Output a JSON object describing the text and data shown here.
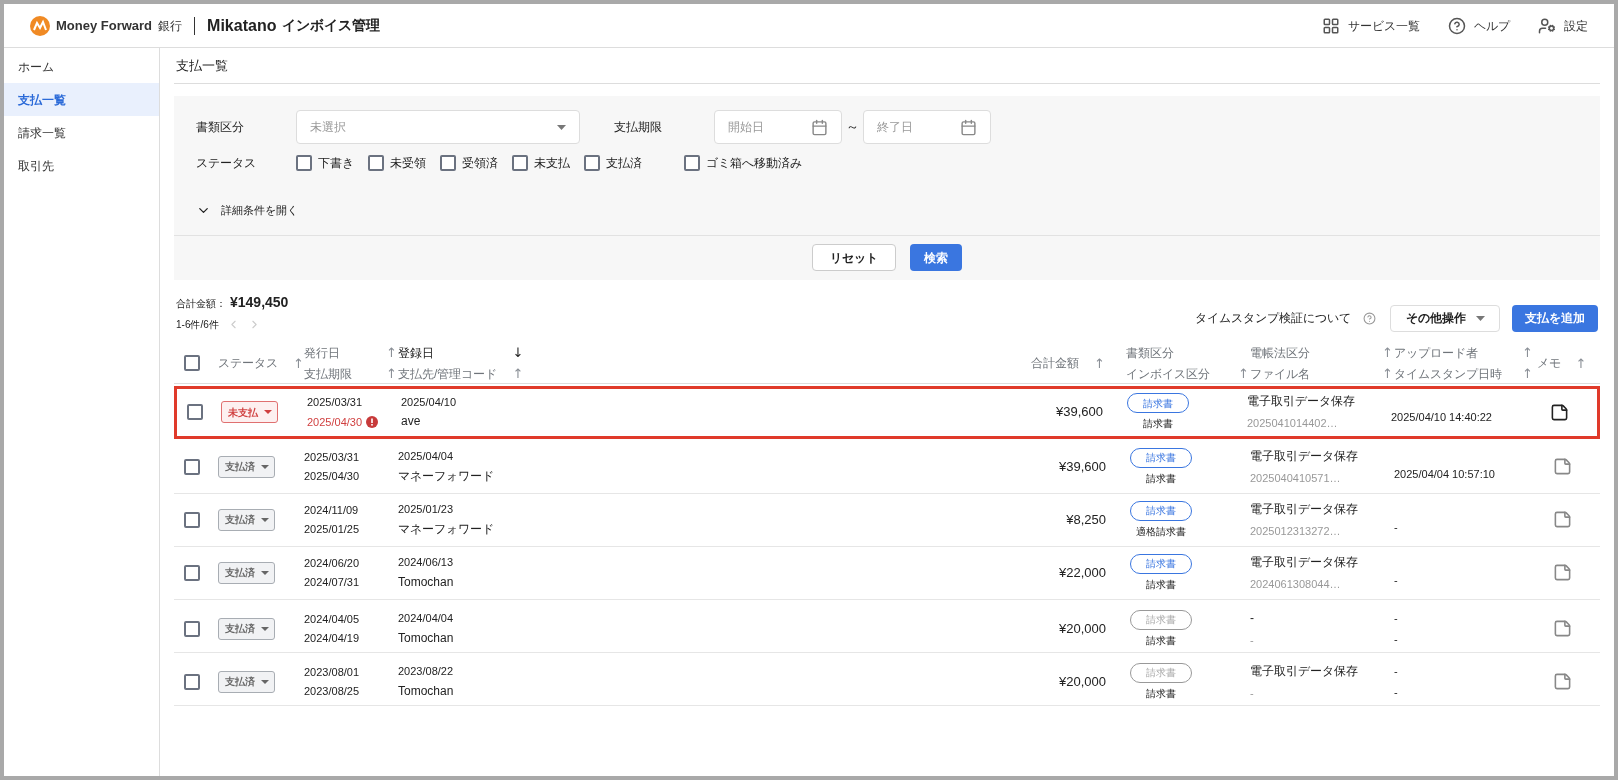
{
  "header": {
    "brand": "Money Forward",
    "brand_sub": "銀行",
    "product": "Mikatano",
    "product_sub": "インボイス管理",
    "nav": [
      {
        "kind": "grid",
        "label": "サービス一覧"
      },
      {
        "kind": "help",
        "label": "ヘルプ"
      },
      {
        "kind": "settings",
        "label": "設定"
      }
    ]
  },
  "sidebar": {
    "items": [
      {
        "label": "ホーム",
        "selected": false
      },
      {
        "label": "支払一覧",
        "selected": true
      },
      {
        "label": "請求一覧",
        "selected": false
      },
      {
        "label": "取引先",
        "selected": false
      }
    ]
  },
  "page_title": "支払一覧",
  "filters": {
    "doc_type": {
      "label": "書類区分",
      "placeholder": "未選択"
    },
    "due": {
      "label": "支払期限",
      "start_placeholder": "開始日",
      "separator": "～",
      "end_placeholder": "終了日"
    },
    "status": {
      "label": "ステータス",
      "options": [
        {
          "label": "下書き",
          "checked": false
        },
        {
          "label": "未受領",
          "checked": false
        },
        {
          "label": "受領済",
          "checked": false
        },
        {
          "label": "未支払",
          "checked": false
        },
        {
          "label": "支払済",
          "checked": false
        },
        {
          "label": "ゴミ箱へ移動済み",
          "checked": false
        }
      ]
    },
    "details_toggle": "詳細条件を開く",
    "reset": "リセット",
    "search": "検索"
  },
  "summary": {
    "total_label": "合計金額：",
    "total": "¥149,450",
    "count": "1-6件/6件"
  },
  "toolbar": {
    "timestamp_link": "タイムスタンプ検証について",
    "other_ops": "その他操作",
    "add": "支払を追加"
  },
  "table": {
    "all_checked": false,
    "columns": [
      {
        "lines": [
          {
            "label": "ステータス",
            "arrow": "↑",
            "active": false
          }
        ]
      },
      {
        "lines": [
          {
            "label": "発行日",
            "arrow": "↑",
            "active": false
          },
          {
            "label": "支払期限",
            "arrow": "↑",
            "active": false
          }
        ]
      },
      {
        "lines": [
          {
            "label": "登録日",
            "arrow": "↓",
            "active": true
          },
          {
            "label": "支払先/管理コード",
            "arrow": "↑",
            "active": false
          }
        ]
      },
      {
        "lines": [
          {
            "label": "合計金額",
            "arrow": "↑",
            "active": false
          }
        ]
      },
      {
        "lines": [
          {
            "label": "書類区分",
            "active": false
          },
          {
            "label": "インボイス区分",
            "arrow": "↑",
            "active": false
          }
        ]
      },
      {
        "lines": [
          {
            "label": "電帳法区分",
            "arrow": "↑",
            "active": false
          },
          {
            "label": "ファイル名",
            "arrow": "↑",
            "active": false
          }
        ]
      },
      {
        "lines": [
          {
            "label": "アップロード者",
            "arrow": "↑",
            "active": false
          },
          {
            "label": "タイムスタンプ日時",
            "arrow": "↑",
            "active": false
          }
        ]
      },
      {
        "lines": [
          {
            "label": "メモ",
            "arrow": "↑",
            "active": false
          }
        ]
      }
    ],
    "rows": [
      {
        "highlighted": true,
        "checked": false,
        "status": {
          "kind": "unpaid",
          "label": "未支払"
        },
        "issue_date": "2025/03/31",
        "due_date": "2025/04/30",
        "overdue": true,
        "registered": "2025/04/10",
        "vendor": "ave",
        "amount": "¥39,600",
        "doc_type": {
          "label": "請求書",
          "active": true
        },
        "invoice_type": "請求書",
        "dencho": "電子取引データ保存",
        "file": "2025041014402…",
        "timestamp": "2025/04/10 14:40:22"
      },
      {
        "highlighted": false,
        "checked": false,
        "status": {
          "kind": "paid",
          "label": "支払済"
        },
        "issue_date": "2025/03/31",
        "due_date": "2025/04/30",
        "overdue": false,
        "registered": "2025/04/04",
        "vendor": "マネーフォワード",
        "amount": "¥39,600",
        "doc_type": {
          "label": "請求書",
          "active": true
        },
        "invoice_type": "請求書",
        "dencho": "電子取引データ保存",
        "file": "2025040410571…",
        "timestamp": "2025/04/04 10:57:10"
      },
      {
        "highlighted": false,
        "checked": false,
        "status": {
          "kind": "paid",
          "label": "支払済"
        },
        "issue_date": "2024/11/09",
        "due_date": "2025/01/25",
        "overdue": false,
        "registered": "2025/01/23",
        "vendor": "マネーフォワード",
        "amount": "¥8,250",
        "doc_type": {
          "label": "請求書",
          "active": true
        },
        "invoice_type": "適格請求書",
        "dencho": "電子取引データ保存",
        "file": "2025012313272…",
        "timestamp": "-"
      },
      {
        "highlighted": false,
        "checked": false,
        "status": {
          "kind": "paid",
          "label": "支払済"
        },
        "issue_date": "2024/06/20",
        "due_date": "2024/07/31",
        "overdue": false,
        "registered": "2024/06/13",
        "vendor": "Tomochan",
        "amount": "¥22,000",
        "doc_type": {
          "label": "請求書",
          "active": true
        },
        "invoice_type": "請求書",
        "dencho": "電子取引データ保存",
        "file": "2024061308044…",
        "timestamp": "-"
      },
      {
        "highlighted": false,
        "checked": false,
        "status": {
          "kind": "paid",
          "label": "支払済"
        },
        "issue_date": "2024/04/05",
        "due_date": "2024/04/19",
        "overdue": false,
        "registered": "2024/04/04",
        "vendor": "Tomochan",
        "amount": "¥20,000",
        "doc_type": {
          "label": "請求書",
          "active": false
        },
        "invoice_type": "請求書",
        "dencho": "-",
        "file": "-",
        "uploader": "-",
        "timestamp": "-"
      },
      {
        "highlighted": false,
        "checked": false,
        "status": {
          "kind": "paid",
          "label": "支払済"
        },
        "issue_date": "2023/08/01",
        "due_date": "2023/08/25",
        "overdue": false,
        "registered": "2023/08/22",
        "vendor": "Tomochan",
        "amount": "¥20,000",
        "doc_type": {
          "label": "請求書",
          "active": false
        },
        "invoice_type": "請求書",
        "dencho": "電子取引データ保存",
        "file": "-",
        "uploader": "-",
        "timestamp": "-"
      }
    ]
  }
}
